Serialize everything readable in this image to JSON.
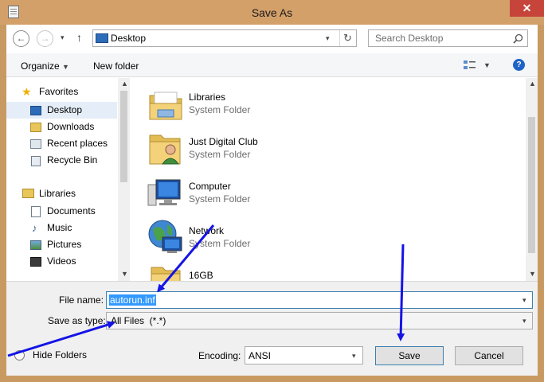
{
  "window": {
    "title": "Save As",
    "close": "✕"
  },
  "nav": {
    "back": "←",
    "forward": "→",
    "recent": "▾",
    "up": "↑",
    "address": "Desktop",
    "refresh": "↻",
    "search_placeholder": "Search Desktop"
  },
  "toolbar": {
    "organize": "Organize",
    "new_folder": "New folder",
    "help": "?"
  },
  "sidebar": {
    "favorites_label": "Favorites",
    "favorites": [
      "Desktop",
      "Downloads",
      "Recent places",
      "Recycle Bin"
    ],
    "libraries_label": "Libraries",
    "libraries": [
      "Documents",
      "Music",
      "Pictures",
      "Videos"
    ]
  },
  "files": [
    {
      "name": "Libraries",
      "type": "System Folder",
      "icon": "libraries-icon"
    },
    {
      "name": "Just Digital Club",
      "type": "System Folder",
      "icon": "user-folder-icon"
    },
    {
      "name": "Computer",
      "type": "System Folder",
      "icon": "computer-icon"
    },
    {
      "name": "Network",
      "type": "System Folder",
      "icon": "network-icon"
    },
    {
      "name": "16GB",
      "type": "",
      "icon": "folder-icon"
    }
  ],
  "form": {
    "filename_label": "File name:",
    "filename_value": "autorun.inf",
    "savetype_label": "Save as type:",
    "savetype_value": "All Files  (*.*)",
    "encoding_label": "Encoding:",
    "encoding_value": "ANSI",
    "hide_folders": "Hide Folders",
    "save": "Save",
    "cancel": "Cancel"
  },
  "colors": {
    "titlebar": "#d4a06a",
    "close": "#c7443a",
    "selection": "#3399ff",
    "annotation_arrow": "#1414e6"
  }
}
